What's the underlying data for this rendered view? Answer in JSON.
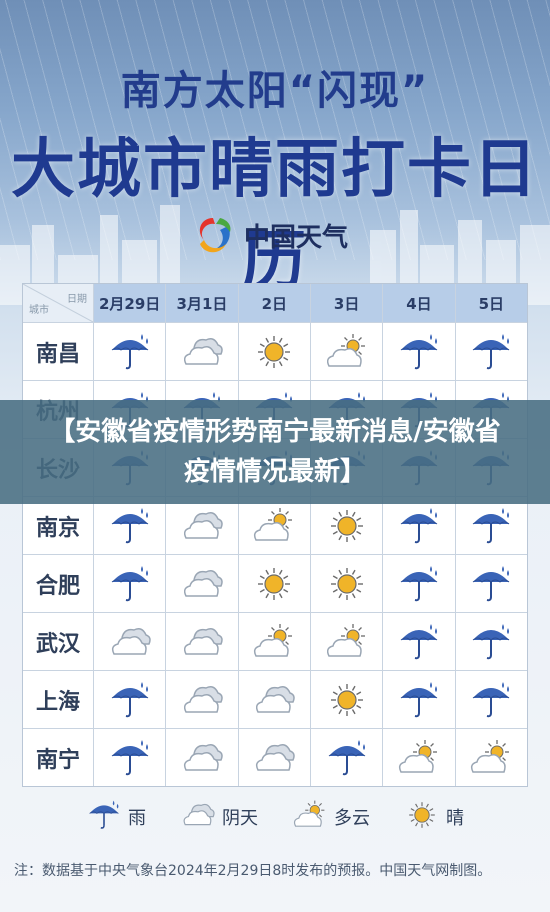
{
  "header": {
    "subtitle": "南方太阳“闪现”",
    "title": "大城市晴雨打卡日历",
    "brand": "中国天气"
  },
  "table": {
    "corner_date_label": "日期",
    "corner_city_label": "城市",
    "dates": [
      "2月29日",
      "3月1日",
      "2日",
      "3日",
      "4日",
      "5日"
    ],
    "rows": [
      {
        "city": "南昌",
        "weather": [
          "rain",
          "cloudy",
          "sunny",
          "partly-cloudy",
          "rain",
          "rain"
        ]
      },
      {
        "city": "杭州",
        "weather": [
          "rain",
          "rain",
          "rain",
          "rain",
          "rain",
          "rain"
        ]
      },
      {
        "city": "长沙",
        "weather": [
          "rain",
          "rain",
          "rain",
          "rain",
          "rain",
          "rain"
        ]
      },
      {
        "city": "南京",
        "weather": [
          "rain",
          "cloudy",
          "partly-cloudy",
          "sunny",
          "rain",
          "rain"
        ]
      },
      {
        "city": "合肥",
        "weather": [
          "rain",
          "cloudy",
          "sunny",
          "sunny",
          "rain",
          "rain"
        ]
      },
      {
        "city": "武汉",
        "weather": [
          "cloudy",
          "cloudy",
          "partly-cloudy",
          "partly-cloudy",
          "rain",
          "rain"
        ]
      },
      {
        "city": "上海",
        "weather": [
          "rain",
          "cloudy",
          "cloudy",
          "sunny",
          "rain",
          "rain"
        ]
      },
      {
        "city": "南宁",
        "weather": [
          "rain",
          "cloudy",
          "cloudy",
          "rain",
          "partly-cloudy",
          "partly-cloudy"
        ]
      }
    ]
  },
  "banner": {
    "text": "【安徽省疫情形势南宁最新消息/安徽省疫情情况最新】"
  },
  "legend": [
    {
      "icon": "rain",
      "label": "雨"
    },
    {
      "icon": "cloudy",
      "label": "阴天"
    },
    {
      "icon": "partly-cloudy",
      "label": "多云"
    },
    {
      "icon": "sunny",
      "label": "晴"
    }
  ],
  "footnote": "注：数据基于中央气象台2024年2月29日8时发布的预报。中国天气网制图。",
  "colors": {
    "title": "#1f3a90",
    "umbrella": "#3a64b7",
    "cloud": "#9aa6b4",
    "sun": "#f0b429",
    "banner": "#486d82"
  }
}
